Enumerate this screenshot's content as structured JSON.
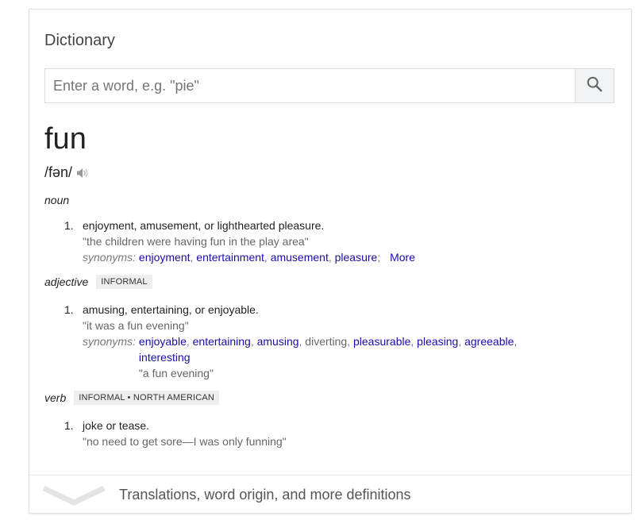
{
  "card": {
    "title": "Dictionary"
  },
  "search": {
    "placeholder": "Enter a word, e.g. \"pie\"",
    "value": ""
  },
  "entry": {
    "word": "fun",
    "pronunciation": "/fən/",
    "noun": {
      "pos": "noun",
      "senses": [
        {
          "number": "1.",
          "definition": "enjoyment, amusement, or lighthearted pleasure.",
          "example": "\"the children were having fun in the play area\"",
          "synonyms_label": "synonyms:",
          "synonyms": [
            "enjoyment",
            "entertainment",
            "amusement",
            "pleasure"
          ],
          "more": "More"
        }
      ]
    },
    "adjective": {
      "pos": "adjective",
      "label": "INFORMAL",
      "senses": [
        {
          "number": "1.",
          "definition": "amusing, entertaining, or enjoyable.",
          "example": "\"it was a fun evening\"",
          "synonyms_label": "synonyms:",
          "synonyms": [
            "enjoyable",
            "entertaining",
            "amusing",
            "diverting",
            "pleasurable",
            "pleasing",
            "agreeable",
            "interesting"
          ],
          "synonym_example": "\"a fun evening\""
        }
      ]
    },
    "verb": {
      "pos": "verb",
      "label": "INFORMAL • NORTH AMERICAN",
      "senses": [
        {
          "number": "1.",
          "definition": "joke or tease.",
          "example": "\"no need to get sore—I was only funning\""
        }
      ]
    }
  },
  "footer": {
    "label": "Translations, word origin, and more definitions"
  },
  "colors": {
    "link": "#1a0dab",
    "badge_bg": "#eeeeee",
    "muted": "#666666"
  },
  "icons": {
    "search": "search-icon",
    "speaker": "speaker-icon",
    "expand": "chevron-down-icon"
  }
}
